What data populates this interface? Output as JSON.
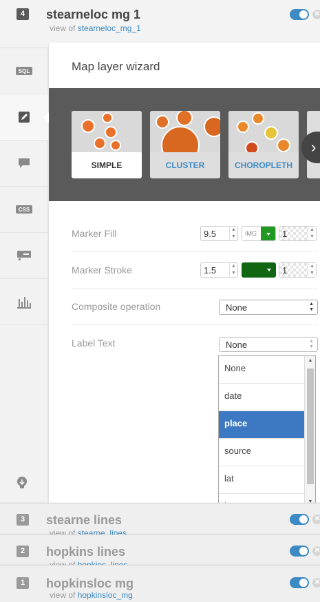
{
  "top_layer": {
    "number": "4",
    "title": "stearneloc mg 1",
    "view_of_prefix": "view of",
    "view_of_table": "stearneloc_mg_1"
  },
  "sidebar": {
    "items": [
      {
        "icon": "sql-icon",
        "label": "SQL"
      },
      {
        "icon": "wizard-edit-icon"
      },
      {
        "icon": "infowindow-comment-icon"
      },
      {
        "icon": "css-icon",
        "label": "CSS"
      },
      {
        "icon": "legend-icon"
      },
      {
        "icon": "bar-chart-icon"
      }
    ],
    "bottom_icon": "bulb-icon"
  },
  "wizard": {
    "title": "Map layer wizard",
    "types": [
      {
        "label": "SIMPLE",
        "selected": true
      },
      {
        "label": "CLUSTER",
        "selected": false
      },
      {
        "label": "CHOROPLETH",
        "selected": false
      }
    ],
    "fields": {
      "marker_fill": {
        "label": "Marker Fill",
        "width": "9.5",
        "image_label": "IMG",
        "color": "#229922",
        "opacity": "1"
      },
      "marker_stroke": {
        "label": "Marker Stroke",
        "width": "1.5",
        "color": "#116611",
        "opacity": "1"
      },
      "composite": {
        "label": "Composite operation",
        "value": "None"
      },
      "label_text": {
        "label": "Label Text",
        "value": "None"
      }
    },
    "label_text_options": [
      "None",
      "date",
      "place",
      "source",
      "lat",
      "long"
    ],
    "label_text_highlighted": "place"
  },
  "other_layers": [
    {
      "number": "3",
      "title": "stearne lines",
      "view_of_prefix": "view of",
      "view_of_table": "stearne_lines"
    },
    {
      "number": "2",
      "title": "hopkins lines",
      "view_of_prefix": "view of",
      "view_of_table": "hopkins_lines"
    },
    {
      "number": "1",
      "title": "hopkinsloc mg",
      "view_of_prefix": "view of",
      "view_of_table": "hopkinsloc_mg"
    }
  ],
  "colors": {
    "accent": "#3d8bc4",
    "selected_option": "#3d79c2",
    "band": "#5a5a5a"
  }
}
